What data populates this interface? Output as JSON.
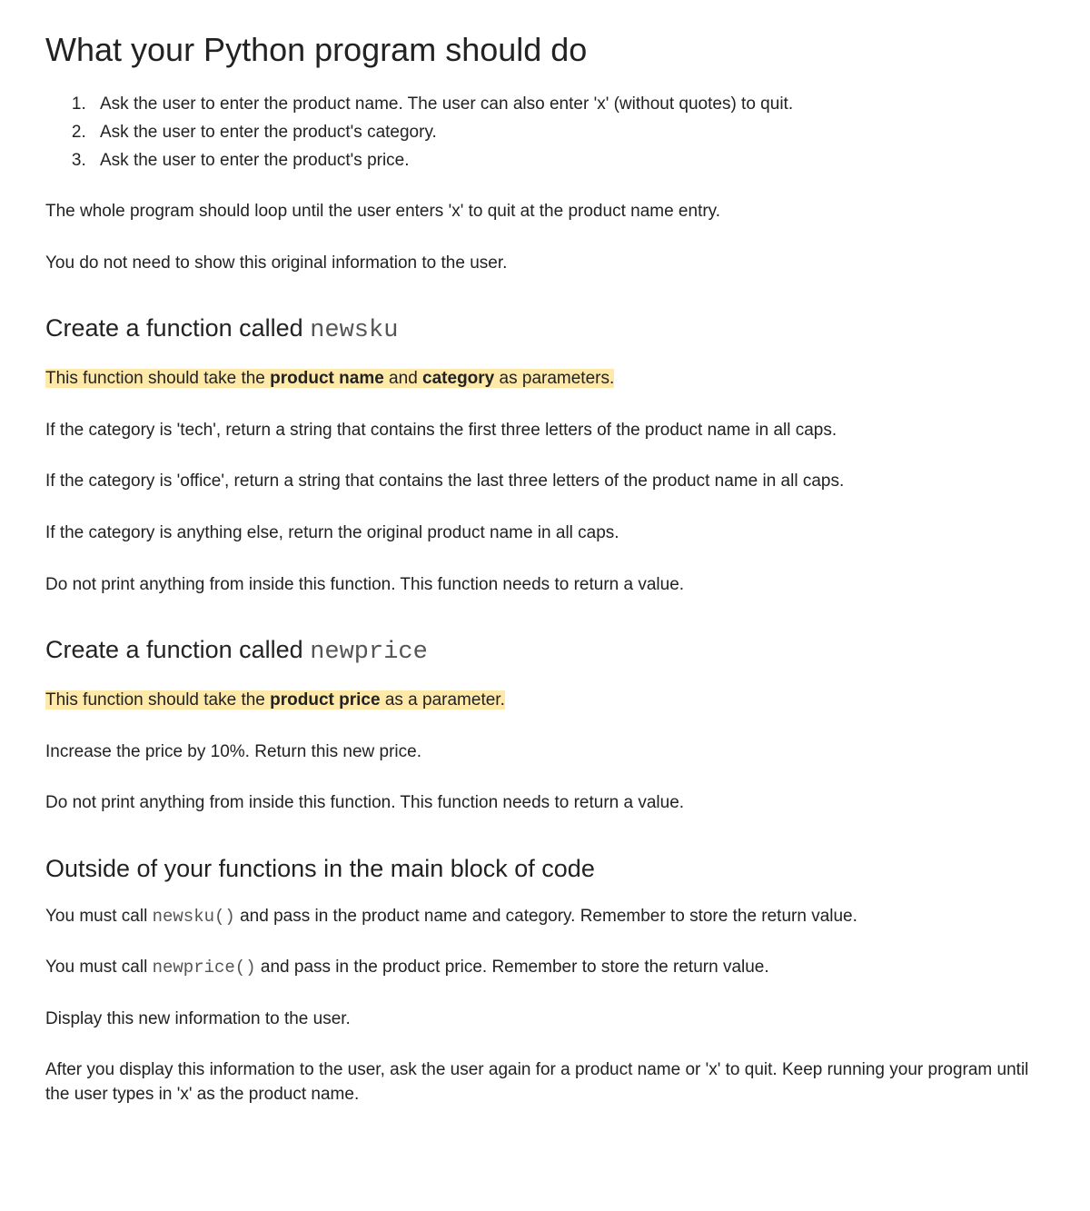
{
  "title": "What your Python program should do",
  "list": {
    "item1": "Ask the user to enter the product name. The user can also enter 'x' (without quotes) to quit.",
    "item2": "Ask the user to enter the product's category.",
    "item3": "Ask the user to enter the product's price."
  },
  "intro": {
    "p1": "The whole program should loop until the user enters 'x' to quit at the product name entry.",
    "p2": "You do not need to show this original information to the user."
  },
  "section1": {
    "heading_prefix": "Create a function called ",
    "heading_code": "newsku",
    "highlight_before": "This function should take the ",
    "highlight_bold1": "product name",
    "highlight_mid": " and ",
    "highlight_bold2": "category",
    "highlight_after": " as parameters.",
    "p1": "If the category is 'tech', return a string that contains the first three letters of the product name in all caps.",
    "p2": "If the category is 'office', return a string that contains the last three letters of the product name in all caps.",
    "p3": "If the category is anything else, return the original product name in all caps.",
    "p4": "Do not print anything from inside this function. This function needs to return a value."
  },
  "section2": {
    "heading_prefix": "Create a function called ",
    "heading_code": "newprice",
    "highlight_before": "This function should take the ",
    "highlight_bold1": "product price",
    "highlight_after": " as a parameter.",
    "p1": "Increase the price by 10%. Return this new price.",
    "p2": "Do not print anything from inside this function. This function needs to return a value."
  },
  "section3": {
    "heading": "Outside of your functions in the main block of code",
    "p1_before": "You must call ",
    "p1_code": "newsku()",
    "p1_after": " and pass in the product name and category. Remember to store the return value.",
    "p2_before": "You must call ",
    "p2_code": "newprice()",
    "p2_after": " and pass in the product price. Remember to store the return value.",
    "p3": "Display this new information to the user.",
    "p4": "After you display this information to the user, ask the user again for a product name or 'x' to quit. Keep running your program until the user types in 'x' as the product name."
  }
}
